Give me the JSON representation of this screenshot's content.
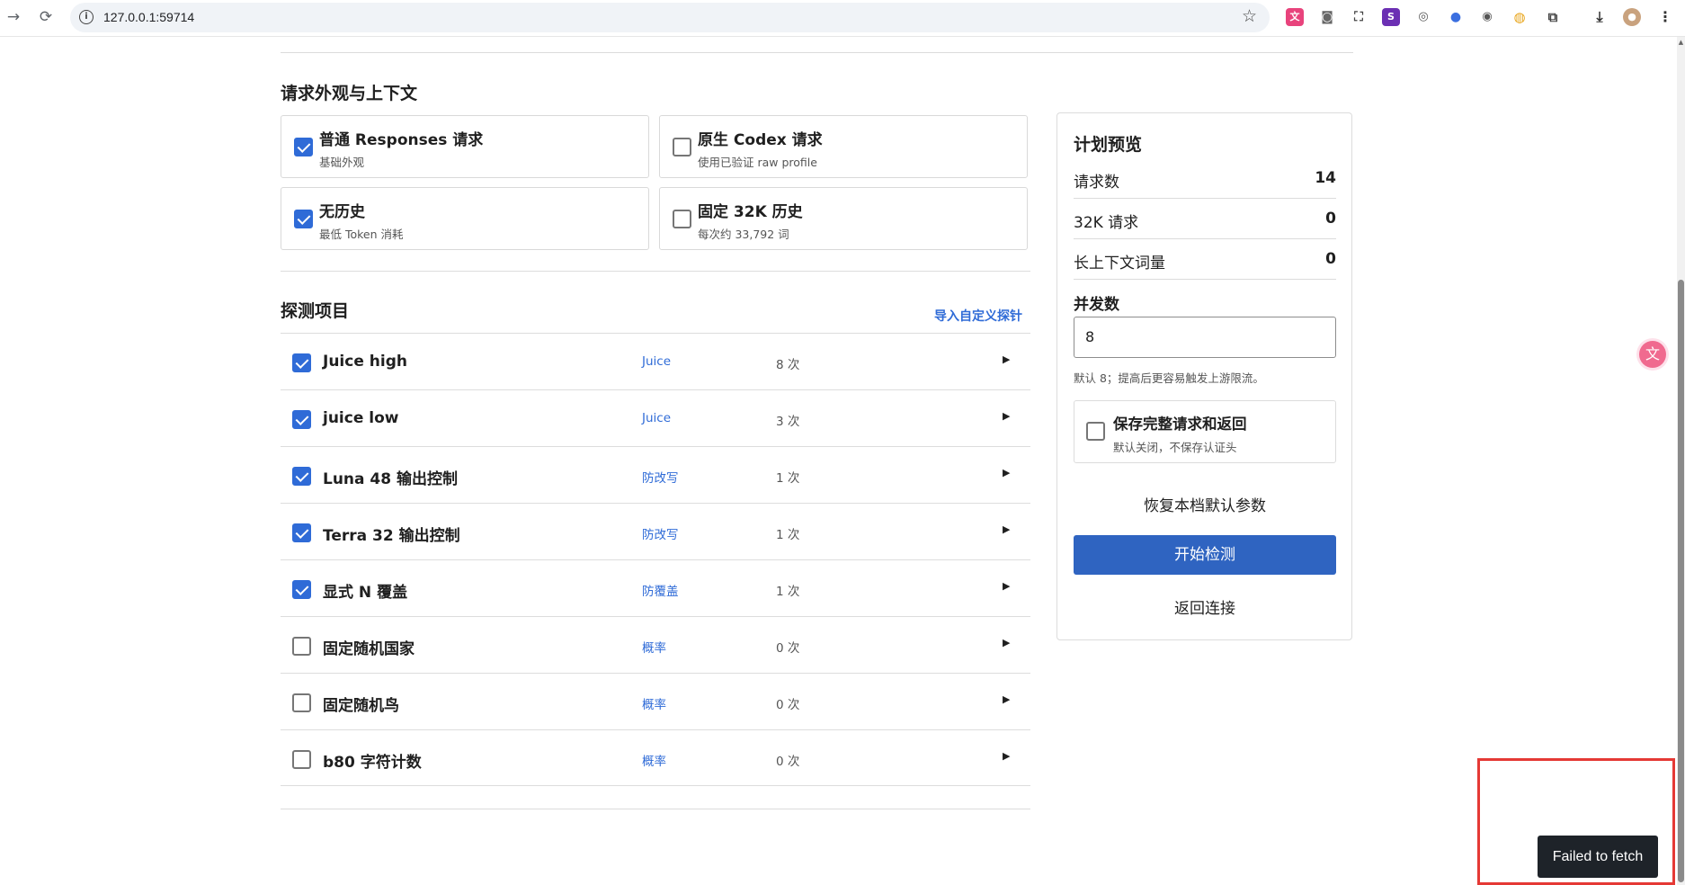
{
  "browser": {
    "url": "127.0.0.1:59714"
  },
  "appearance": {
    "title": "请求外观与上下文",
    "options": [
      {
        "label": "普通 Responses 请求",
        "desc": "基础外观",
        "checked": true
      },
      {
        "label": "原生 Codex 请求",
        "desc": "使用已验证 raw profile",
        "checked": false
      },
      {
        "label": "无历史",
        "desc": "最低 Token 消耗",
        "checked": true
      },
      {
        "label": "固定 32K 历史",
        "desc": "每次约 33,792 词",
        "checked": false
      }
    ]
  },
  "probes": {
    "title": "探测项目",
    "import_link": "导入自定义探针",
    "items": [
      {
        "name": "Juice high",
        "tag": "Juice",
        "count": "8 次",
        "checked": true
      },
      {
        "name": "juice low",
        "tag": "Juice",
        "count": "3 次",
        "checked": true
      },
      {
        "name": "Luna 48 输出控制",
        "tag": "防改写",
        "count": "1 次",
        "checked": true
      },
      {
        "name": "Terra 32 输出控制",
        "tag": "防改写",
        "count": "1 次",
        "checked": true
      },
      {
        "name": "显式 N 覆盖",
        "tag": "防覆盖",
        "count": "1 次",
        "checked": true
      },
      {
        "name": "固定随机国家",
        "tag": "概率",
        "count": "0 次",
        "checked": false
      },
      {
        "name": "固定随机鸟",
        "tag": "概率",
        "count": "0 次",
        "checked": false
      },
      {
        "name": "b80 字符计数",
        "tag": "概率",
        "count": "0 次",
        "checked": false
      }
    ]
  },
  "plan": {
    "title": "计划预览",
    "stats": [
      {
        "label": "请求数",
        "value": "14"
      },
      {
        "label": "32K 请求",
        "value": "0"
      },
      {
        "label": "长上下文词量",
        "value": "0"
      }
    ],
    "concurrency_label": "并发数",
    "concurrency_value": "8",
    "concurrency_hint": "默认 8；提高后更容易触发上游限流。",
    "save_title": "保存完整请求和返回",
    "save_desc": "默认关闭，不保存认证头",
    "save_checked": false,
    "reset_label": "恢复本档默认参数",
    "start_label": "开始检测",
    "back_label": "返回连接"
  },
  "toast": {
    "message": "Failed to fetch"
  },
  "colors": {
    "accent": "#2f6bd7",
    "primary_button": "#2f64c1",
    "toast_bg": "#1e2329",
    "highlight_box": "#e53935"
  }
}
